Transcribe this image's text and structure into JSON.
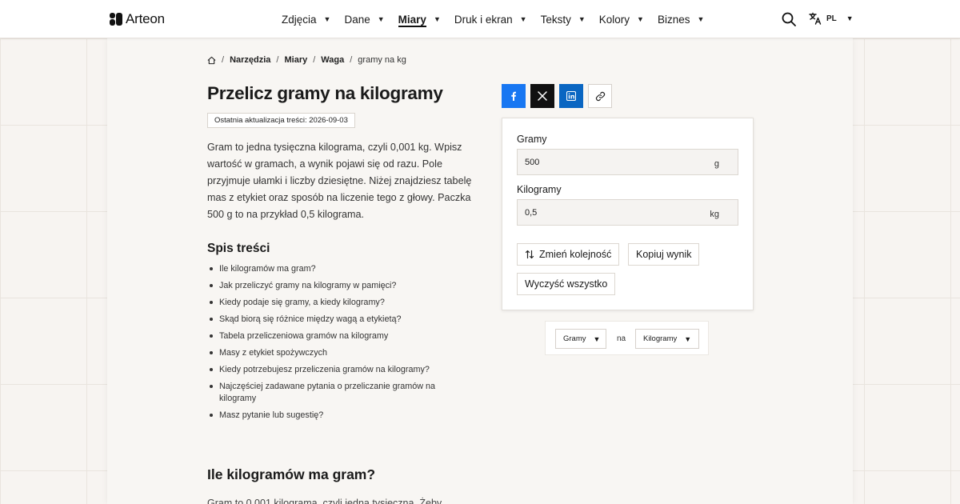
{
  "header": {
    "logo_text": "Arteon",
    "nav": [
      {
        "label": "Zdjęcia",
        "active": false
      },
      {
        "label": "Dane",
        "active": false
      },
      {
        "label": "Miary",
        "active": true
      },
      {
        "label": "Druk i ekran",
        "active": false
      },
      {
        "label": "Teksty",
        "active": false
      },
      {
        "label": "Kolory",
        "active": false
      },
      {
        "label": "Biznes",
        "active": false
      }
    ],
    "search_icon": "search-icon",
    "language": "PL",
    "language_icon": "translate-icon"
  },
  "breadcrumb": {
    "items": [
      "Narzędzia",
      "Miary",
      "Waga"
    ],
    "current": "gramy na kg"
  },
  "page": {
    "title": "Przelicz gramy na kilogramy",
    "updated": "Ostatnia aktualizacja treści: 2026-09-03",
    "intro": "Gram to jedna tysięczna kilograma, czyli 0,001 kg. Wpisz wartość w gramach, a wynik pojawi się od razu. Pole przyjmuje ułamki i liczby dziesiętne. Niżej znajdziesz tabelę mas z etykiet oraz sposób na liczenie tego z głowy. Paczka 500 g to na przykład 0,5 kilograma.",
    "toc_title": "Spis treści",
    "toc": [
      "Ile kilogramów ma gram?",
      "Jak przeliczyć gramy na kilogramy w pamięci?",
      "Kiedy podaje się gramy, a kiedy kilogramy?",
      "Skąd biorą się różnice między wagą a etykietą?",
      "Tabela przeliczeniowa gramów na kilogramy",
      "Masy z etykiet spożywczych",
      "Kiedy potrzebujesz przeliczenia gramów na kilogramy?",
      "Najczęściej zadawane pytania o przeliczanie gramów na kilogramy",
      "Masz pytanie lub sugestię?"
    ],
    "section_heading": "Ile kilogramów ma gram?",
    "section_text": "Gram to 0,001 kilograma, czyli jedna tysięczna. Żeby"
  },
  "converter": {
    "from_label": "Gramy",
    "from_value": "500",
    "from_unit": "g",
    "to_label": "Kilogramy",
    "to_value": "0,5",
    "to_unit": "kg",
    "swap_label": "Zmień kolejność",
    "copy_label": "Kopiuj wynik",
    "clear_label": "Wyczyść wszystko"
  },
  "unit_selector": {
    "from": "Gramy",
    "joiner": "na",
    "to": "Kilogramy"
  }
}
